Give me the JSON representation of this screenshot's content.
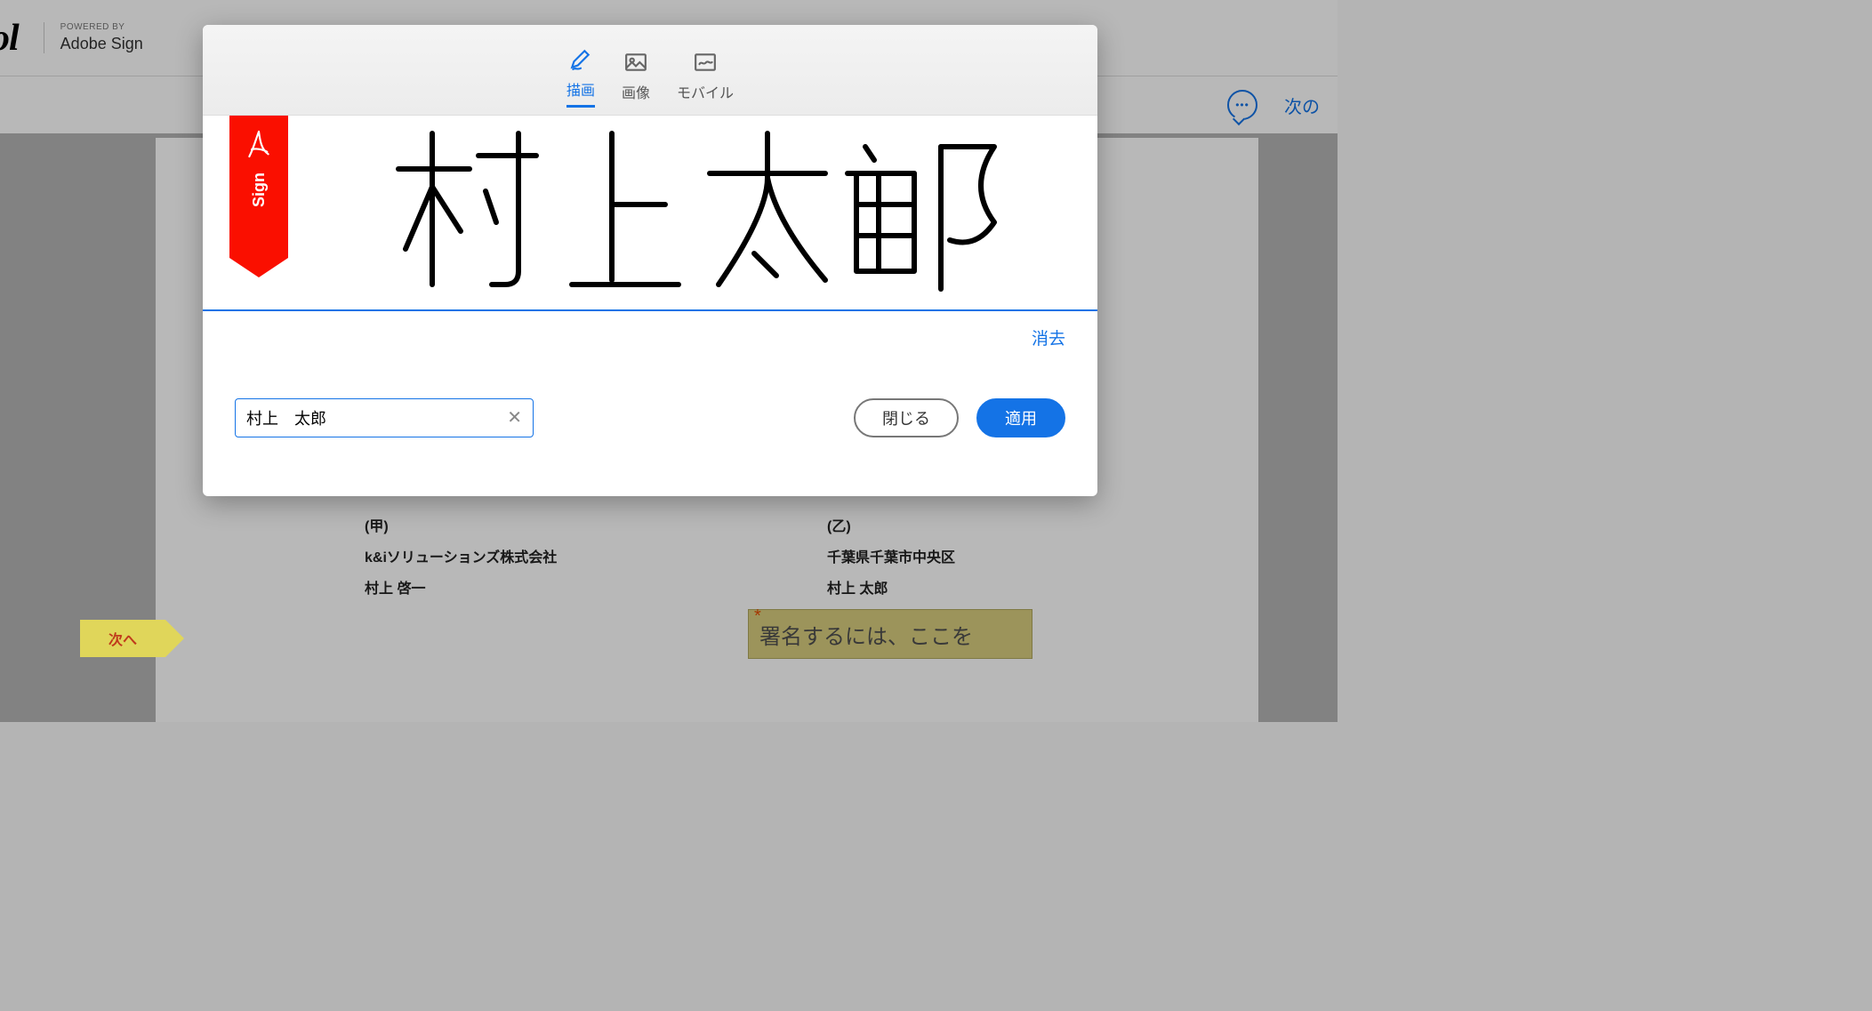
{
  "header": {
    "logo_fragment": "ol",
    "powered_small": "POWERED BY",
    "powered_big": "Adobe Sign"
  },
  "toolbar": {
    "next": "次の"
  },
  "document": {
    "party_a": {
      "label": "(甲)",
      "company": "k&iソリューションズ株式会社",
      "name": "村上 啓一"
    },
    "party_b": {
      "label": "(乙)",
      "address": "千葉県千葉市中央区",
      "name": "村上 太郎"
    },
    "sig_placeholder": "署名するには、ここを",
    "next_flag": "次へ"
  },
  "modal": {
    "tabs": {
      "draw": "描画",
      "image": "画像",
      "mobile": "モバイル"
    },
    "ribbon_label": "Sign",
    "clear": "消去",
    "name_value": "村上　太郎",
    "close": "閉じる",
    "apply": "適用",
    "handwritten_name": "村上太郎"
  }
}
